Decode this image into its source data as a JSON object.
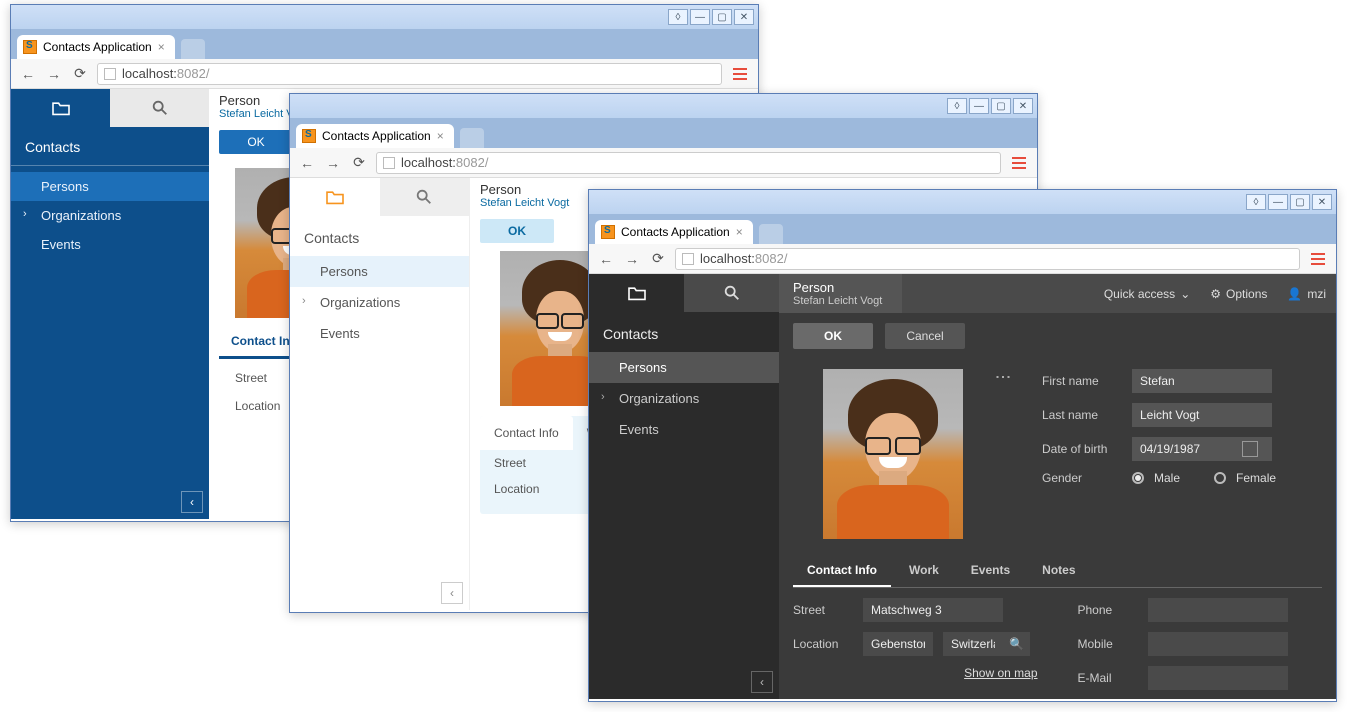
{
  "browser": {
    "tab_title": "Contacts Application",
    "url_host": "localhost:",
    "url_port": "8082/"
  },
  "sidebar": {
    "heading": "Contacts",
    "items": [
      {
        "label": "Persons"
      },
      {
        "label": "Organizations"
      },
      {
        "label": "Events"
      }
    ]
  },
  "header": {
    "title": "Person",
    "subtitle": "Stefan Leicht Vogt",
    "quick_access": "Quick access",
    "options": "Options",
    "user": "mzi"
  },
  "buttons": {
    "ok": "OK",
    "cancel": "Cancel"
  },
  "detail_tabs": {
    "contact_info": "Contact Info",
    "work": "Work",
    "events": "Events",
    "notes": "Notes",
    "w2_second": "W"
  },
  "person": {
    "first_name_label": "First name",
    "first_name": "Stefan",
    "last_name_label": "Last name",
    "last_name": "Leicht Vogt",
    "dob_label": "Date of birth",
    "dob": "04/19/1987",
    "gender_label": "Gender",
    "gender_male": "Male",
    "gender_female": "Female"
  },
  "contact": {
    "street_label": "Street",
    "street": "Matschweg 3",
    "location_label": "Location",
    "city": "Gebenstorf",
    "country": "Switzerlan",
    "show_on_map": "Show on map",
    "phone_label": "Phone",
    "mobile_label": "Mobile",
    "email_label": "E-Mail"
  },
  "w2_contact": {
    "street_val": "Mat",
    "city_val": "Gebe"
  }
}
